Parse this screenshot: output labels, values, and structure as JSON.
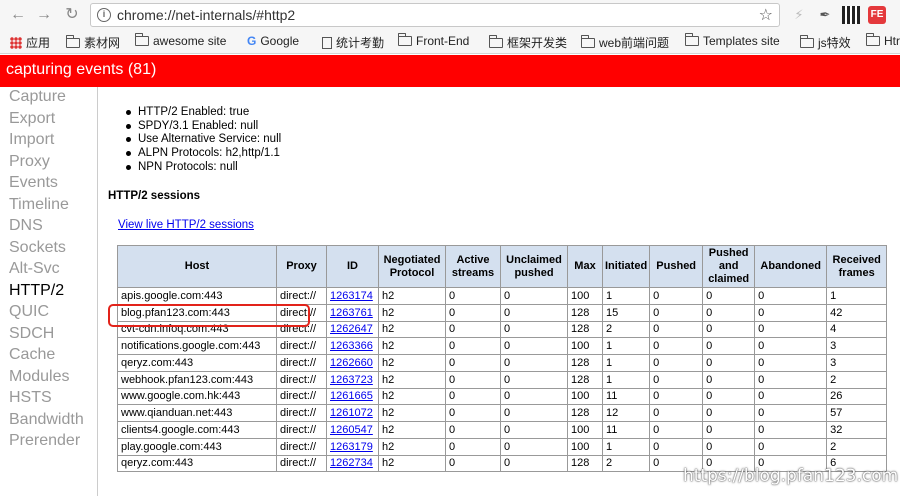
{
  "browser": {
    "url": "chrome://net-internals/#http2",
    "icons": [
      "back-icon",
      "forward-icon",
      "reload-icon",
      "info-icon",
      "star-icon"
    ]
  },
  "bookmarks": [
    {
      "label": "应用",
      "icon": "apps-icon"
    },
    {
      "label": "素材网",
      "icon": "folder-icon"
    },
    {
      "label": "awesome site",
      "icon": "folder-icon"
    },
    {
      "label": "Google",
      "icon": "google-icon"
    },
    {
      "label": "统计考勤",
      "icon": "doc-icon"
    },
    {
      "label": "Front-End",
      "icon": "folder-icon"
    },
    {
      "label": "框架开发类",
      "icon": "folder-icon"
    },
    {
      "label": "web前端问题",
      "icon": "folder-icon"
    },
    {
      "label": "Templates site",
      "icon": "folder-icon"
    },
    {
      "label": "js特效",
      "icon": "folder-icon"
    },
    {
      "label": "Htr",
      "icon": "folder-icon"
    }
  ],
  "status": {
    "text": "capturing events (81)",
    "color": "#ff0000"
  },
  "sidebar": {
    "items": [
      {
        "label": "Capture"
      },
      {
        "label": "Export"
      },
      {
        "label": "Import"
      },
      {
        "label": "Proxy"
      },
      {
        "label": "Events"
      },
      {
        "label": "Timeline"
      },
      {
        "label": "DNS"
      },
      {
        "label": "Sockets"
      },
      {
        "label": "Alt-Svc"
      },
      {
        "label": "HTTP/2"
      },
      {
        "label": "QUIC"
      },
      {
        "label": "SDCH"
      },
      {
        "label": "Cache"
      },
      {
        "label": "Modules"
      },
      {
        "label": "HSTS"
      },
      {
        "label": "Bandwidth"
      },
      {
        "label": "Prerender"
      }
    ],
    "active": "HTTP/2"
  },
  "info": [
    "HTTP/2 Enabled: true",
    "SPDY/3.1 Enabled: null",
    "Use Alternative Service: null",
    "ALPN Protocols: h2,http/1.1",
    "NPN Protocols: null"
  ],
  "sessions": {
    "heading": "HTTP/2 sessions",
    "view_live_link": "View live HTTP/2 sessions",
    "columns": [
      "Host",
      "Proxy",
      "ID",
      "Negotiated Protocol",
      "Active streams",
      "Unclaimed pushed",
      "Max",
      "Initiated",
      "Pushed",
      "Pushed and claimed",
      "Abandoned",
      "Received frames"
    ],
    "rows": [
      [
        "apis.google.com:443",
        "direct://",
        "1263174",
        "h2",
        "0",
        "0",
        "100",
        "1",
        "0",
        "0",
        "0",
        "1"
      ],
      [
        "blog.pfan123.com:443",
        "direct://",
        "1263761",
        "h2",
        "0",
        "0",
        "128",
        "15",
        "0",
        "0",
        "0",
        "42"
      ],
      [
        "cvt-cdn.infoq.com:443",
        "direct://",
        "1262647",
        "h2",
        "0",
        "0",
        "128",
        "2",
        "0",
        "0",
        "0",
        "4"
      ],
      [
        "notifications.google.com:443",
        "direct://",
        "1263366",
        "h2",
        "0",
        "0",
        "100",
        "1",
        "0",
        "0",
        "0",
        "3"
      ],
      [
        "qeryz.com:443",
        "direct://",
        "1262660",
        "h2",
        "0",
        "0",
        "128",
        "1",
        "0",
        "0",
        "0",
        "3"
      ],
      [
        "webhook.pfan123.com:443",
        "direct://",
        "1263723",
        "h2",
        "0",
        "0",
        "128",
        "1",
        "0",
        "0",
        "0",
        "2"
      ],
      [
        "www.google.com.hk:443",
        "direct://",
        "1261665",
        "h2",
        "0",
        "0",
        "100",
        "11",
        "0",
        "0",
        "0",
        "26"
      ],
      [
        "www.qianduan.net:443",
        "direct://",
        "1261072",
        "h2",
        "0",
        "0",
        "128",
        "12",
        "0",
        "0",
        "0",
        "57"
      ],
      [
        "clients4.google.com:443",
        "direct://",
        "1260547",
        "h2",
        "0",
        "0",
        "100",
        "11",
        "0",
        "0",
        "0",
        "32"
      ],
      [
        "play.google.com:443",
        "direct://",
        "1263179",
        "h2",
        "0",
        "0",
        "100",
        "1",
        "0",
        "0",
        "0",
        "2"
      ],
      [
        "qeryz.com:443",
        "direct://",
        "1262734",
        "h2",
        "0",
        "0",
        "128",
        "2",
        "0",
        "0",
        "0",
        "6"
      ]
    ]
  },
  "watermark": "https://blog.pfan123.com",
  "highlight_color": "#e2231a"
}
